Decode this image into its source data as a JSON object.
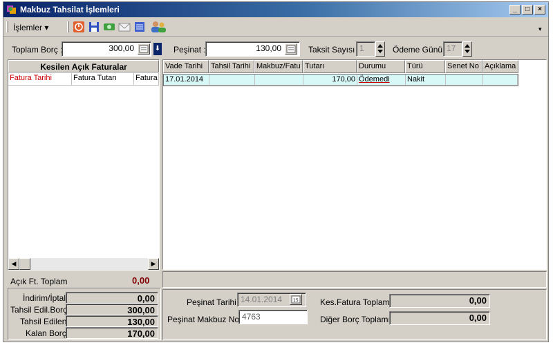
{
  "window": {
    "title": "Makbuz Tahsilat İşlemleri"
  },
  "toolbar": {
    "menu_label": "İşlemler"
  },
  "top": {
    "toplam_borc_label": "Toplam Borç :",
    "toplam_borc_value": "300,00",
    "pesinat_label": "Peşinat :",
    "pesinat_value": "130,00",
    "taksit_label": "Taksit Sayısı :",
    "taksit_value": "1",
    "odeme_gunu_label": "Ödeme Günü :",
    "odeme_gunu_value": "17"
  },
  "left_panel": {
    "title": "Kesilen Açık Faturalar",
    "columns": [
      "Fatura Tarihi",
      "Fatura Tutarı",
      "Fatura"
    ],
    "acik_ft_label": "Açık Ft. Toplam",
    "acik_ft_value": "0,00"
  },
  "grid": {
    "columns": [
      "Vade Tarihi",
      "Tahsil Tarihi",
      "Makbuz/Fatu",
      "Tutarı",
      "Durumu",
      "Türü",
      "Senet No",
      "Açıklama"
    ],
    "rows": [
      [
        "17.01.2014",
        "",
        "",
        "170,00",
        "Ödemedi",
        "Nakit",
        "",
        ""
      ]
    ]
  },
  "summary": {
    "indirim_label": "İndirim/İptal",
    "indirim_value": "0,00",
    "tahsil_edil_borc_label": "Tahsil Edil.Borç",
    "tahsil_edil_borc_value": "300,00",
    "tahsil_edilen_label": "Tahsil Edilen",
    "tahsil_edilen_value": "130,00",
    "kalan_borc_label": "Kalan Borç",
    "kalan_borc_value": "170,00"
  },
  "bottom": {
    "pesinat_tarihi_label": "Peşinat Tarihi",
    "pesinat_tarihi_value": "14.01.2014",
    "pesinat_makbuz_label": "Peşinat Makbuz No",
    "pesinat_makbuz_value": "4763",
    "kes_fatura_label": "Kes.Fatura Toplamı",
    "kes_fatura_value": "0,00",
    "diger_borc_label": "Diğer Borç Toplamı",
    "diger_borc_value": "0,00"
  },
  "colors": {
    "title_start": "#0a246a",
    "selected_row": "#d8f8f8",
    "red_text": "#cc0000",
    "maroon_value": "#800000"
  }
}
